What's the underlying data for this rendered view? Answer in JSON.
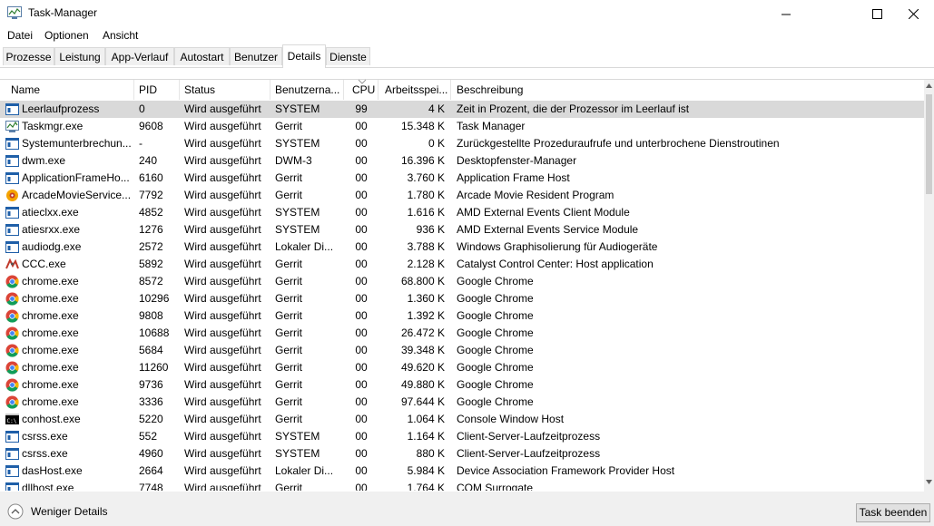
{
  "window": {
    "title": "Task-Manager",
    "icons": {
      "app": "task-manager-icon",
      "minimize": "minimize-icon",
      "maximize": "maximize-icon",
      "close": "close-icon"
    }
  },
  "menu": [
    "Datei",
    "Optionen",
    "Ansicht"
  ],
  "tabs": [
    {
      "label": "Prozesse",
      "active": false
    },
    {
      "label": "Leistung",
      "active": false
    },
    {
      "label": "App-Verlauf",
      "active": false
    },
    {
      "label": "Autostart",
      "active": false
    },
    {
      "label": "Benutzer",
      "active": false
    },
    {
      "label": "Details",
      "active": true
    },
    {
      "label": "Dienste",
      "active": false
    }
  ],
  "table": {
    "columns": [
      "Name",
      "PID",
      "Status",
      "Benutzerna...",
      "CPU",
      "Arbeitsspei...",
      "Beschreibung"
    ],
    "sort_column": "CPU",
    "selected_row": 0,
    "colors": {
      "selected": "#d9d9d9",
      "header_sep": "#e5e5e5"
    },
    "rows": [
      {
        "icon": "window-icon",
        "name": "Leerlaufprozess",
        "pid": "0",
        "status": "Wird ausgeführt",
        "user": "SYSTEM",
        "cpu": "99",
        "mem": "4 K",
        "desc": "Zeit in Prozent, die der Prozessor im Leerlauf ist"
      },
      {
        "icon": "task-manager-icon",
        "name": "Taskmgr.exe",
        "pid": "9608",
        "status": "Wird ausgeführt",
        "user": "Gerrit",
        "cpu": "00",
        "mem": "15.348 K",
        "desc": "Task Manager"
      },
      {
        "icon": "window-icon",
        "name": "Systemunterbrechun...",
        "pid": "-",
        "status": "Wird ausgeführt",
        "user": "SYSTEM",
        "cpu": "00",
        "mem": "0 K",
        "desc": "Zurückgestellte Prozeduraufrufe und unterbrochene Dienstroutinen"
      },
      {
        "icon": "window-icon",
        "name": "dwm.exe",
        "pid": "240",
        "status": "Wird ausgeführt",
        "user": "DWM-3",
        "cpu": "00",
        "mem": "16.396 K",
        "desc": "Desktopfenster-Manager"
      },
      {
        "icon": "window-icon",
        "name": "ApplicationFrameHo...",
        "pid": "6160",
        "status": "Wird ausgeführt",
        "user": "Gerrit",
        "cpu": "00",
        "mem": "3.760 K",
        "desc": "Application Frame Host"
      },
      {
        "icon": "arcade-icon",
        "name": "ArcadeMovieService....",
        "pid": "7792",
        "status": "Wird ausgeführt",
        "user": "Gerrit",
        "cpu": "00",
        "mem": "1.780 K",
        "desc": "Arcade Movie Resident Program"
      },
      {
        "icon": "window-icon",
        "name": "atieclxx.exe",
        "pid": "4852",
        "status": "Wird ausgeführt",
        "user": "SYSTEM",
        "cpu": "00",
        "mem": "1.616 K",
        "desc": "AMD External Events Client Module"
      },
      {
        "icon": "window-icon",
        "name": "atiesrxx.exe",
        "pid": "1276",
        "status": "Wird ausgeführt",
        "user": "SYSTEM",
        "cpu": "00",
        "mem": "936 K",
        "desc": "AMD External Events Service Module"
      },
      {
        "icon": "window-icon",
        "name": "audiodg.exe",
        "pid": "2572",
        "status": "Wird ausgeführt",
        "user": "Lokaler Di...",
        "cpu": "00",
        "mem": "3.788 K",
        "desc": "Windows Graphisolierung für Audiogeräte"
      },
      {
        "icon": "catalyst-icon",
        "name": "CCC.exe",
        "pid": "5892",
        "status": "Wird ausgeführt",
        "user": "Gerrit",
        "cpu": "00",
        "mem": "2.128 K",
        "desc": "Catalyst Control Center: Host application"
      },
      {
        "icon": "chrome-icon",
        "name": "chrome.exe",
        "pid": "8572",
        "status": "Wird ausgeführt",
        "user": "Gerrit",
        "cpu": "00",
        "mem": "68.800 K",
        "desc": "Google Chrome"
      },
      {
        "icon": "chrome-icon",
        "name": "chrome.exe",
        "pid": "10296",
        "status": "Wird ausgeführt",
        "user": "Gerrit",
        "cpu": "00",
        "mem": "1.360 K",
        "desc": "Google Chrome"
      },
      {
        "icon": "chrome-icon",
        "name": "chrome.exe",
        "pid": "9808",
        "status": "Wird ausgeführt",
        "user": "Gerrit",
        "cpu": "00",
        "mem": "1.392 K",
        "desc": "Google Chrome"
      },
      {
        "icon": "chrome-icon",
        "name": "chrome.exe",
        "pid": "10688",
        "status": "Wird ausgeführt",
        "user": "Gerrit",
        "cpu": "00",
        "mem": "26.472 K",
        "desc": "Google Chrome"
      },
      {
        "icon": "chrome-icon",
        "name": "chrome.exe",
        "pid": "5684",
        "status": "Wird ausgeführt",
        "user": "Gerrit",
        "cpu": "00",
        "mem": "39.348 K",
        "desc": "Google Chrome"
      },
      {
        "icon": "chrome-icon",
        "name": "chrome.exe",
        "pid": "11260",
        "status": "Wird ausgeführt",
        "user": "Gerrit",
        "cpu": "00",
        "mem": "49.620 K",
        "desc": "Google Chrome"
      },
      {
        "icon": "chrome-icon",
        "name": "chrome.exe",
        "pid": "9736",
        "status": "Wird ausgeführt",
        "user": "Gerrit",
        "cpu": "00",
        "mem": "49.880 K",
        "desc": "Google Chrome"
      },
      {
        "icon": "chrome-icon",
        "name": "chrome.exe",
        "pid": "3336",
        "status": "Wird ausgeführt",
        "user": "Gerrit",
        "cpu": "00",
        "mem": "97.644 K",
        "desc": "Google Chrome"
      },
      {
        "icon": "console-icon",
        "name": "conhost.exe",
        "pid": "5220",
        "status": "Wird ausgeführt",
        "user": "Gerrit",
        "cpu": "00",
        "mem": "1.064 K",
        "desc": "Console Window Host"
      },
      {
        "icon": "window-icon",
        "name": "csrss.exe",
        "pid": "552",
        "status": "Wird ausgeführt",
        "user": "SYSTEM",
        "cpu": "00",
        "mem": "1.164 K",
        "desc": "Client-Server-Laufzeitprozess"
      },
      {
        "icon": "window-icon",
        "name": "csrss.exe",
        "pid": "4960",
        "status": "Wird ausgeführt",
        "user": "SYSTEM",
        "cpu": "00",
        "mem": "880 K",
        "desc": "Client-Server-Laufzeitprozess"
      },
      {
        "icon": "window-icon",
        "name": "dasHost.exe",
        "pid": "2664",
        "status": "Wird ausgeführt",
        "user": "Lokaler Di...",
        "cpu": "00",
        "mem": "5.984 K",
        "desc": "Device Association Framework Provider Host"
      },
      {
        "icon": "window-icon",
        "name": "dllhost.exe",
        "pid": "7748",
        "status": "Wird ausgeführt",
        "user": "Gerrit",
        "cpu": "00",
        "mem": "1.764 K",
        "desc": "COM Surrogate"
      }
    ]
  },
  "footer": {
    "less_details": "Weniger Details",
    "less_icon": "chevron-up-circle-icon",
    "end_task": "Task beenden"
  }
}
